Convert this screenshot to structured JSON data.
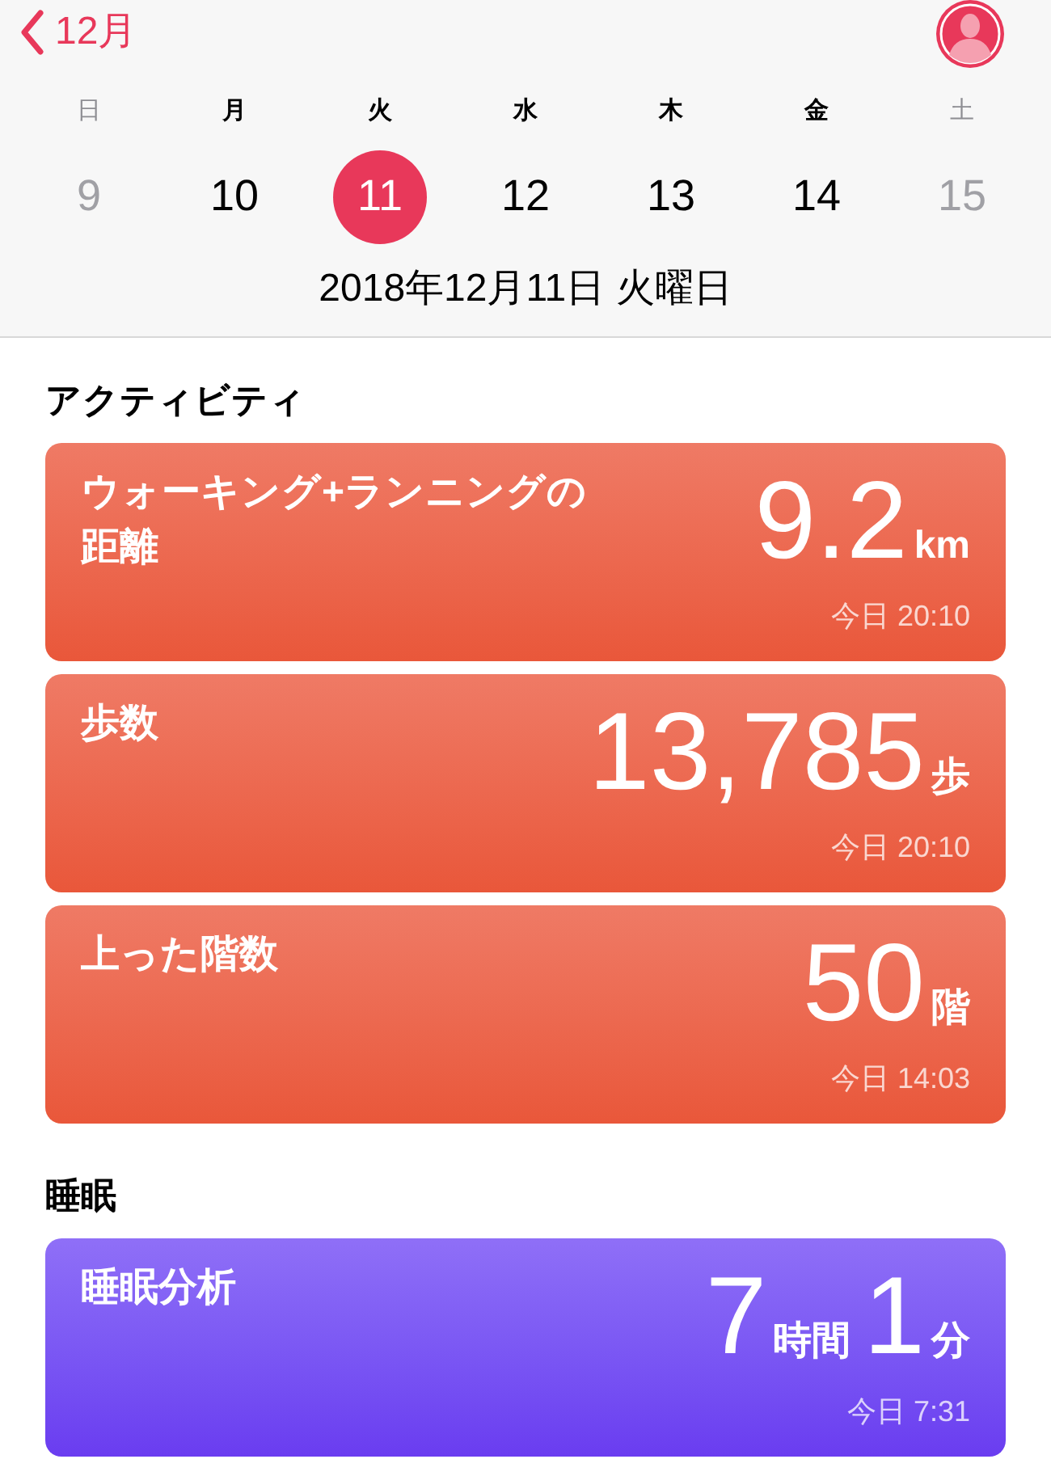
{
  "header": {
    "back_label": "12月",
    "weekdays": [
      {
        "label": "日",
        "dimmed": true
      },
      {
        "label": "月",
        "dimmed": false
      },
      {
        "label": "火",
        "dimmed": false
      },
      {
        "label": "水",
        "dimmed": false
      },
      {
        "label": "木",
        "dimmed": false
      },
      {
        "label": "金",
        "dimmed": false
      },
      {
        "label": "土",
        "dimmed": true
      }
    ],
    "days": [
      {
        "label": "9",
        "dimmed": true,
        "selected": false
      },
      {
        "label": "10",
        "dimmed": false,
        "selected": false
      },
      {
        "label": "11",
        "dimmed": false,
        "selected": true
      },
      {
        "label": "12",
        "dimmed": false,
        "selected": false
      },
      {
        "label": "13",
        "dimmed": false,
        "selected": false
      },
      {
        "label": "14",
        "dimmed": false,
        "selected": false
      },
      {
        "label": "15",
        "dimmed": true,
        "selected": false
      }
    ],
    "date_title": "2018年12月11日 火曜日"
  },
  "sections": [
    {
      "title": "アクティビティ",
      "cards": [
        {
          "kind": "activity",
          "title": "ウォーキング+ランニングの距離",
          "parts": [
            {
              "kind": "number",
              "text": "9.2"
            },
            {
              "kind": "unit",
              "text": "km"
            }
          ],
          "time": "今日 20:10"
        },
        {
          "kind": "activity",
          "title": "歩数",
          "parts": [
            {
              "kind": "number",
              "text": "13,785"
            },
            {
              "kind": "unit",
              "text": "歩"
            }
          ],
          "time": "今日 20:10"
        },
        {
          "kind": "activity",
          "title": "上った階数",
          "parts": [
            {
              "kind": "number",
              "text": "50"
            },
            {
              "kind": "unit",
              "text": "階"
            }
          ],
          "time": "今日 14:03"
        }
      ]
    },
    {
      "title": "睡眠",
      "cards": [
        {
          "kind": "sleep",
          "title": "睡眠分析",
          "parts": [
            {
              "kind": "number",
              "text": "7"
            },
            {
              "kind": "unit",
              "text": "時間"
            },
            {
              "kind": "number",
              "text": "1"
            },
            {
              "kind": "unit",
              "text": "分"
            }
          ],
          "time": "今日 7:31"
        }
      ]
    }
  ]
}
